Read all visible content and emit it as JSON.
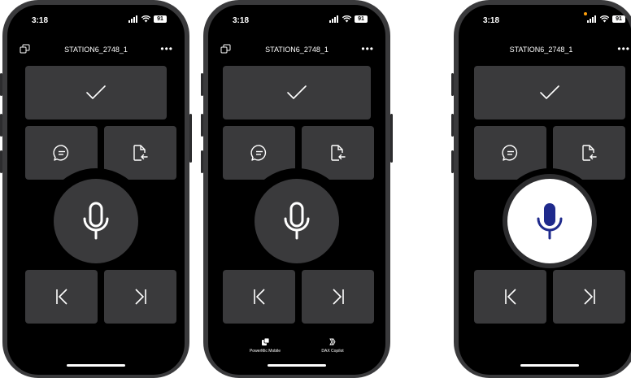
{
  "phones": [
    {
      "status": {
        "time": "3:18",
        "battery": "91"
      },
      "header": {
        "title": "STATION6_2748_1",
        "more": "•••"
      },
      "mic_active": false,
      "bottom_tabs": []
    },
    {
      "status": {
        "time": "3:18",
        "battery": "91"
      },
      "header": {
        "title": "STATION6_2748_1",
        "more": "•••"
      },
      "mic_active": false,
      "bottom_tabs": [
        {
          "label": "PowerMic Mobile",
          "icon": "powermic-icon"
        },
        {
          "label": "DAX Copilot",
          "icon": "dax-copilot-icon"
        }
      ]
    },
    {
      "status": {
        "time": "3:18",
        "battery": "91"
      },
      "header": {
        "title": "STATION6_2748_1",
        "more": "•••"
      },
      "mic_active": true,
      "bottom_tabs": []
    }
  ],
  "icons": {
    "accept": "checkmark-icon",
    "comment": "comment-icon",
    "document": "document-transfer-icon",
    "mic": "microphone-icon",
    "previous": "skip-back-icon",
    "next": "skip-forward-icon",
    "switch": "switch-app-icon"
  },
  "colors": {
    "screen_bg": "#000000",
    "tile_bg": "#3a3a3c",
    "mic_active_bg": "#ffffff",
    "mic_active_icon": "#1f2a8c",
    "recording_dot": "#ff9f0a"
  }
}
